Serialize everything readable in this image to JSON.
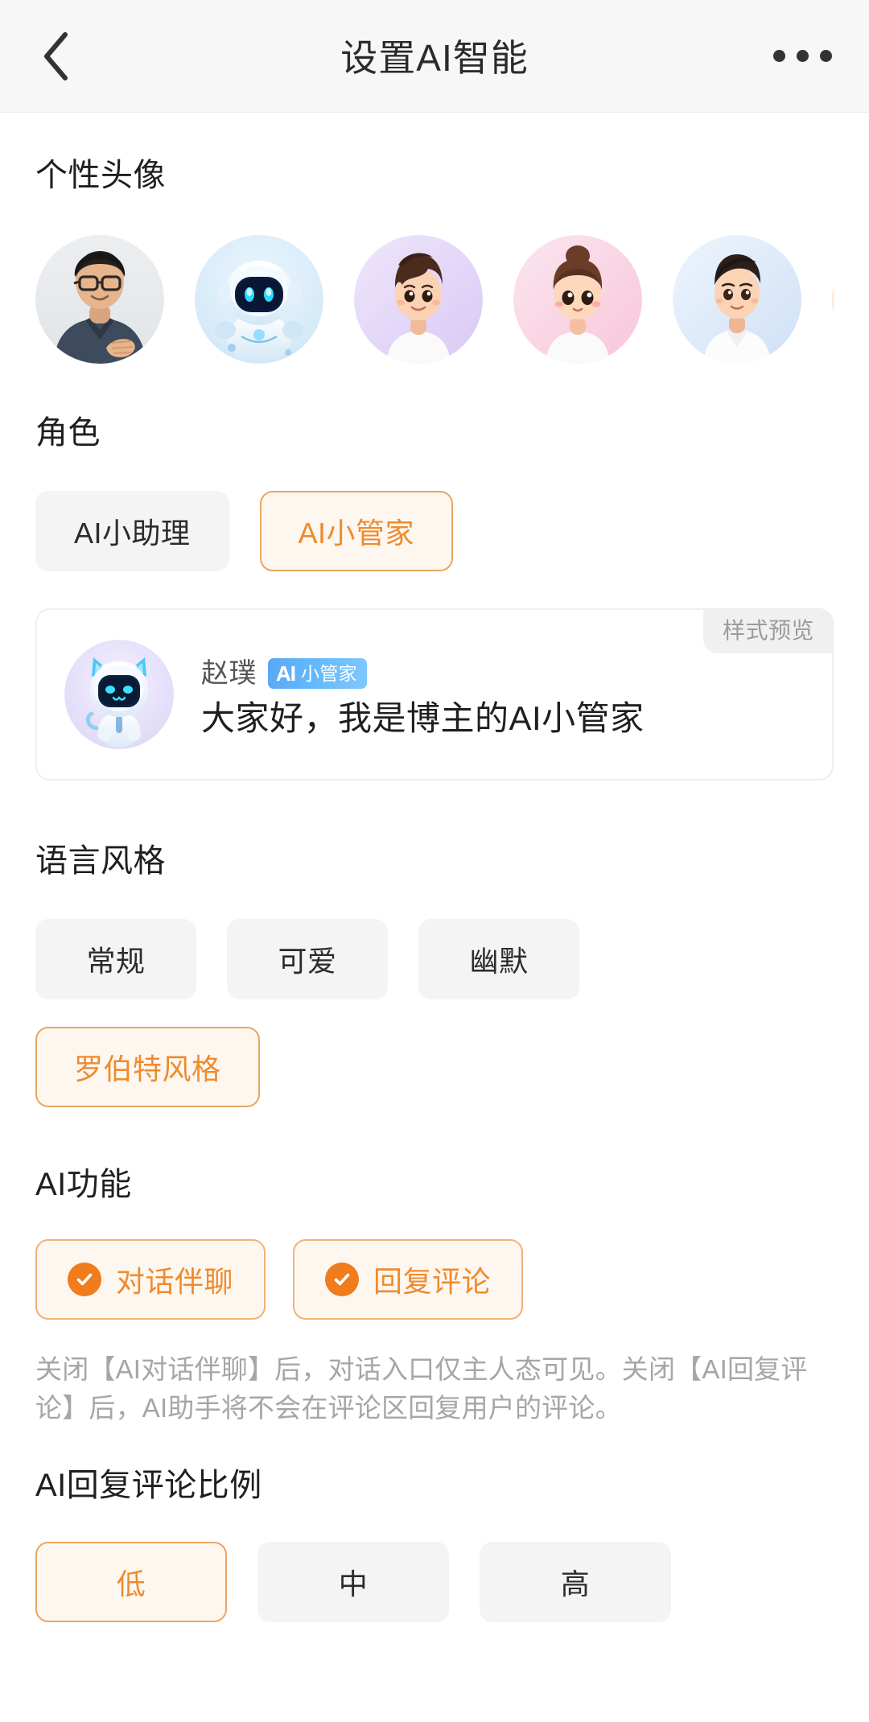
{
  "nav": {
    "title": "设置AI智能",
    "back_icon": "chevron-left-icon",
    "more_icon": "more-horizontal-icon"
  },
  "sections": {
    "avatar": {
      "title": "个性头像",
      "items": [
        {
          "name": "avatar-photo-man",
          "selected": false
        },
        {
          "name": "avatar-robot-blue",
          "selected": false
        },
        {
          "name": "avatar-boy-purple",
          "selected": false
        },
        {
          "name": "avatar-girl-pink",
          "selected": false
        },
        {
          "name": "avatar-young-man-blue",
          "selected": false
        },
        {
          "name": "avatar-partial-peach",
          "selected": false
        }
      ]
    },
    "role": {
      "title": "角色",
      "options": [
        {
          "label": "AI小助理",
          "selected": false
        },
        {
          "label": "AI小管家",
          "selected": true
        }
      ]
    },
    "preview": {
      "tag": "样式预览",
      "avatar_icon": "cat-robot-avatar",
      "name": "赵璞",
      "badge_mark": "AI",
      "badge_role": "小管家",
      "message": "大家好，我是博主的AI小管家"
    },
    "language_style": {
      "title": "语言风格",
      "options": [
        {
          "label": "常规",
          "selected": false
        },
        {
          "label": "可爱",
          "selected": false
        },
        {
          "label": "幽默",
          "selected": false
        },
        {
          "label": "罗伯特风格",
          "selected": true
        }
      ]
    },
    "ai_features": {
      "title": "AI功能",
      "options": [
        {
          "label": "对话伴聊",
          "selected": true,
          "icon": "check-circle-icon"
        },
        {
          "label": "回复评论",
          "selected": true,
          "icon": "check-circle-icon"
        }
      ],
      "description": "关闭【AI对话伴聊】后，对话入口仅主人态可见。关闭【AI回复评论】后，AI助手将不会在评论区回复用户的评论。"
    },
    "reply_ratio": {
      "title": "AI回复评论比例",
      "options": [
        {
          "label": "低",
          "selected": true
        },
        {
          "label": "中",
          "selected": false
        },
        {
          "label": "高",
          "selected": false
        }
      ]
    }
  },
  "colors": {
    "accent": "#ef8b2c",
    "accent_strong": "#f07c1d",
    "accent_border": "#e9a661",
    "accent_bg": "#fdf7f0",
    "chip_bg": "#f4f4f4",
    "text_primary": "#1f1f1f",
    "text_muted": "#a6a6a6",
    "badge_blue": "#5aa8f5",
    "nav_bg": "#f7f7f7"
  }
}
